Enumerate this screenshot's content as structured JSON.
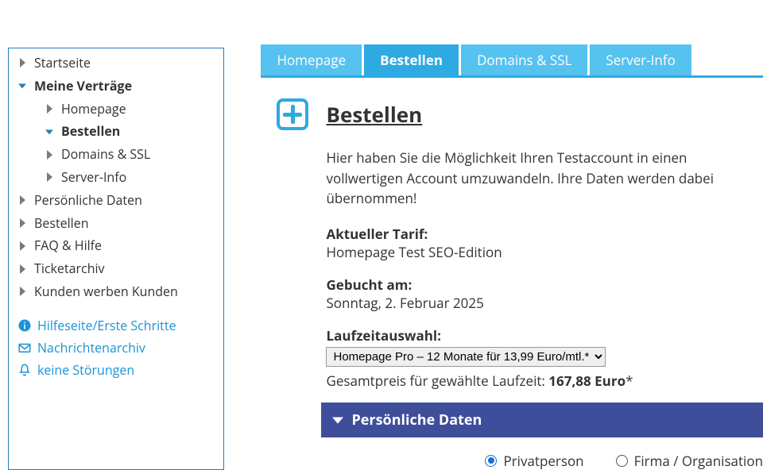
{
  "sidebar": {
    "items": [
      {
        "label": "Startseite",
        "level": 1,
        "expanded": false
      },
      {
        "label": "Meine Verträge",
        "level": 1,
        "expanded": true,
        "open": true
      },
      {
        "label": "Homepage",
        "level": 2,
        "expanded": false
      },
      {
        "label": "Bestellen",
        "level": 2,
        "expanded": true,
        "open": true
      },
      {
        "label": "Domains & SSL",
        "level": 2,
        "expanded": false
      },
      {
        "label": "Server-Info",
        "level": 2,
        "expanded": false
      },
      {
        "label": "Persönliche Daten",
        "level": 1,
        "expanded": false
      },
      {
        "label": "Bestellen",
        "level": 1,
        "expanded": false
      },
      {
        "label": "FAQ & Hilfe",
        "level": 1,
        "expanded": false
      },
      {
        "label": "Ticketarchiv",
        "level": 1,
        "expanded": false
      },
      {
        "label": "Kunden werben Kunden",
        "level": 1,
        "expanded": false
      }
    ],
    "links": {
      "help": "Hilfeseite/Erste Schritte",
      "archive": "Nachrichtenarchiv",
      "status": "keine Störungen"
    }
  },
  "tabs": [
    {
      "label": "Homepage",
      "selected": false
    },
    {
      "label": "Bestellen",
      "selected": true
    },
    {
      "label": "Domains & SSL",
      "selected": false
    },
    {
      "label": "Server-Info",
      "selected": false
    }
  ],
  "page": {
    "title": "Bestellen",
    "intro": "Hier haben Sie die Möglichkeit Ihren Testaccount in einen vollwertigen Account umzuwandeln. Ihre Daten werden dabei übernommen!",
    "currentTariffLabel": "Aktueller Tarif:",
    "currentTariff": "Homepage Test SEO-Edition",
    "bookedOnLabel": "Gebucht am:",
    "bookedOn": "Sonntag, 2. Februar 2025",
    "runtimeLabel": "Laufzeitauswahl:",
    "runtimeSelected": "Homepage Pro – 12 Monate für 13,99 Euro/mtl.*",
    "totalPrefix": "Gesamtpreis für gewählte Laufzeit: ",
    "totalAmount": "167,88 Euro",
    "totalSuffix": "*",
    "accordion": "Persönliche Daten",
    "radio": {
      "private": "Privatperson",
      "company": "Firma / Organisation"
    }
  }
}
